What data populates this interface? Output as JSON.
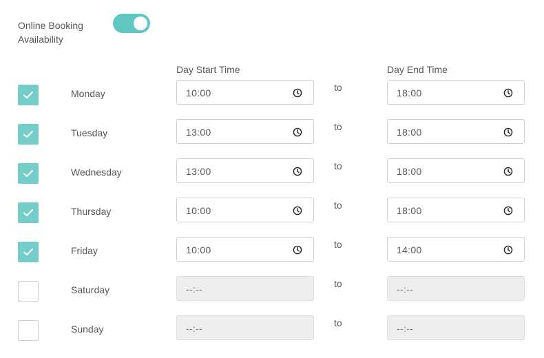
{
  "availability": {
    "label_line1": "Online Booking",
    "label_line2": "Availability",
    "enabled": true
  },
  "headers": {
    "start": "Day Start Time",
    "end": "Day End Time"
  },
  "connector": "to",
  "colors": {
    "accent": "#5ec7c2",
    "checkbox_checked": "#74cdc9",
    "disabled_input": "#eeeeee"
  },
  "days": [
    {
      "name": "Monday",
      "checked": true,
      "start": "10:00",
      "end": "18:00",
      "enabled": true
    },
    {
      "name": "Tuesday",
      "checked": true,
      "start": "13:00",
      "end": "18:00",
      "enabled": true
    },
    {
      "name": "Wednesday",
      "checked": true,
      "start": "13:00",
      "end": "18:00",
      "enabled": true
    },
    {
      "name": "Thursday",
      "checked": true,
      "start": "10:00",
      "end": "18:00",
      "enabled": true
    },
    {
      "name": "Friday",
      "checked": true,
      "start": "10:00",
      "end": "14:00",
      "enabled": true
    },
    {
      "name": "Saturday",
      "checked": false,
      "start": "--:--",
      "end": "--:--",
      "enabled": false
    },
    {
      "name": "Sunday",
      "checked": false,
      "start": "--:--",
      "end": "--:--",
      "enabled": false
    }
  ]
}
